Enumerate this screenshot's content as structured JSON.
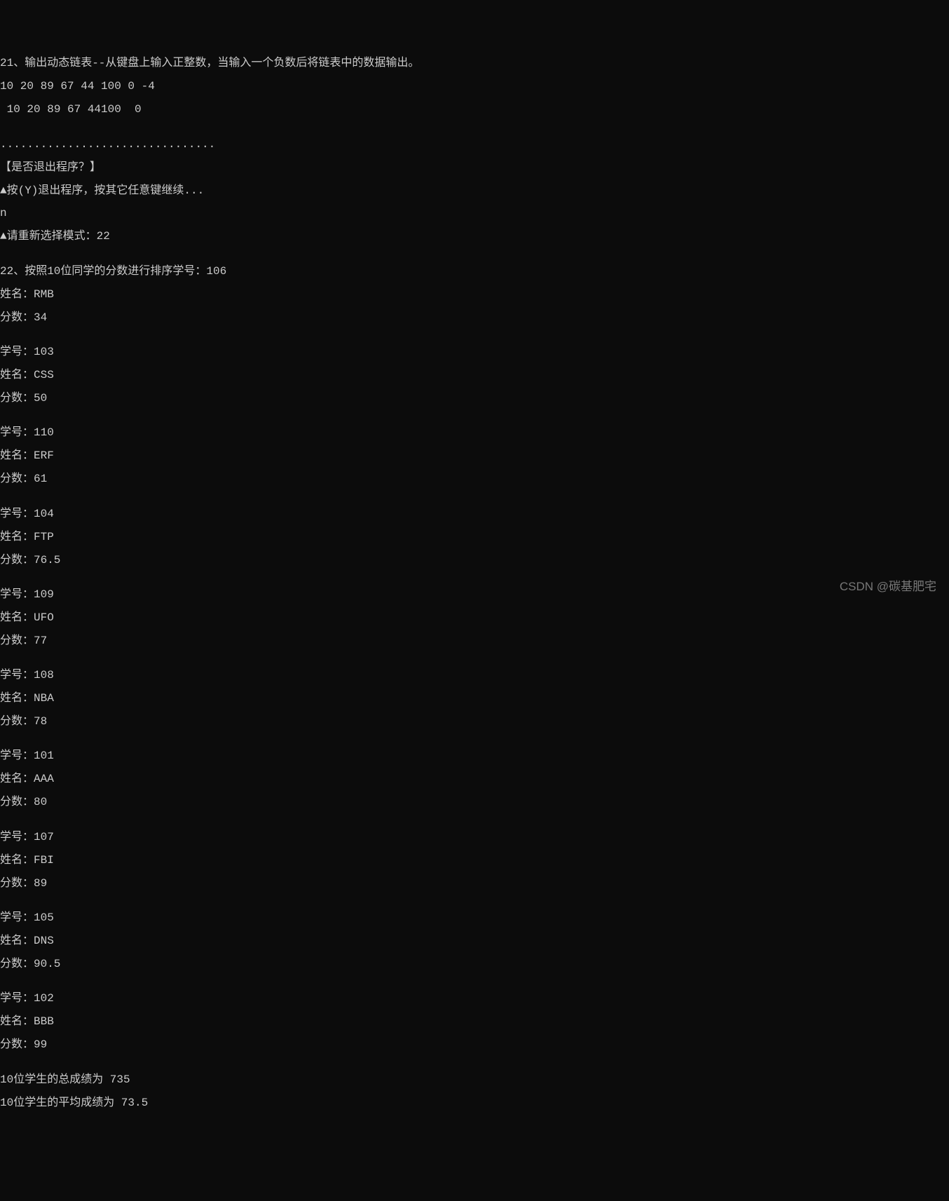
{
  "terminal": {
    "line01": "21、输出动态链表--从键盘上输入正整数，当输入一个负数后将链表中的数据输出。",
    "line02": "10 20 89 67 44 100 0 -4",
    "line03": " 10 20 89 67 44100  0",
    "line04": "",
    "line05": "................................",
    "line06": "【是否退出程序？】",
    "line07": "▲按(Y)退出程序，按其它任意键继续...",
    "line08": "n",
    "line09": "▲请重新选择模式：22",
    "line10": "",
    "line11": "22、按照10位同学的分数进行排序学号：106",
    "line12": "姓名：RMB",
    "line13": "分数：34",
    "line14": "",
    "line15": "学号：103",
    "line16": "姓名：CSS",
    "line17": "分数：50",
    "line18": "",
    "line19": "学号：110",
    "line20": "姓名：ERF",
    "line21": "分数：61",
    "line22": "",
    "line23": "学号：104",
    "line24": "姓名：FTP",
    "line25": "分数：76.5",
    "line26": "",
    "line27": "学号：109",
    "line28": "姓名：UFO",
    "line29": "分数：77",
    "line30": "",
    "line31": "学号：108",
    "line32": "姓名：NBA",
    "line33": "分数：78",
    "line34": "",
    "line35": "学号：101",
    "line36": "姓名：AAA",
    "line37": "分数：80",
    "line38": "",
    "line39": "学号：107",
    "line40": "姓名：FBI",
    "line41": "分数：89",
    "line42": "",
    "line43": "学号：105",
    "line44": "姓名：DNS",
    "line45": "分数：90.5",
    "line46": "",
    "line47": "学号：102",
    "line48": "姓名：BBB",
    "line49": "分数：99",
    "line50": "",
    "line51": "10位学生的总成绩为 735",
    "line52": "10位学生的平均成绩为 73.5"
  },
  "watermark": "CSDN @碳基肥宅"
}
